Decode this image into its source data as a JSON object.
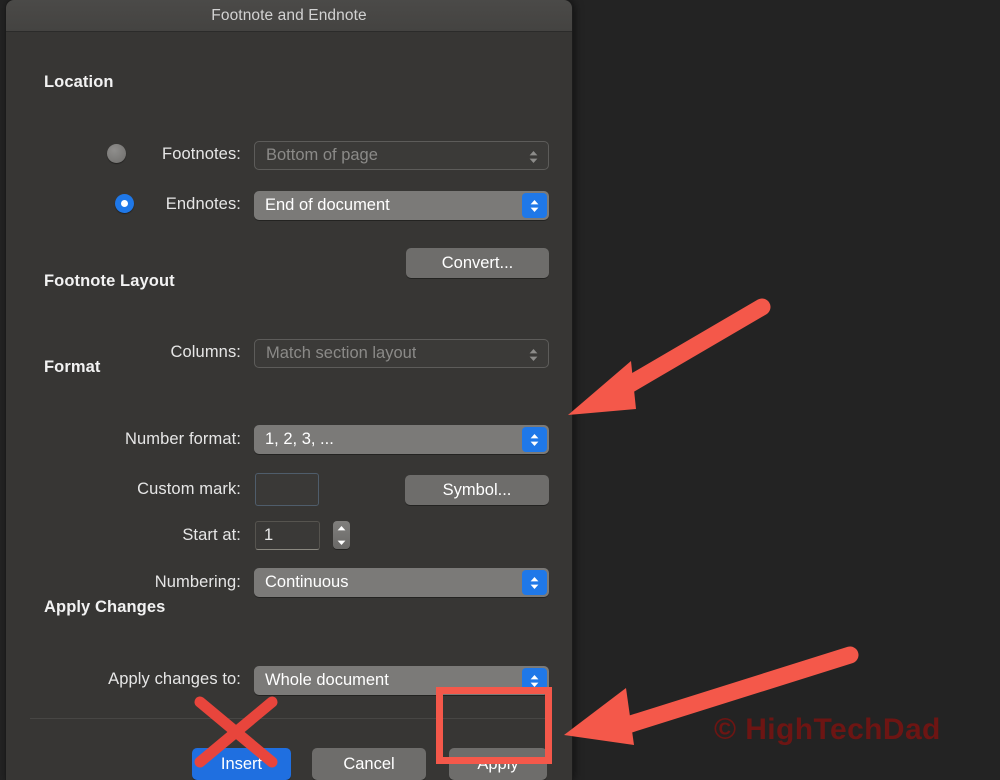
{
  "window": {
    "title": "Footnote and Endnote"
  },
  "sections": {
    "location": "Location",
    "footnote_layout": "Footnote Layout",
    "format": "Format",
    "apply_changes": "Apply Changes"
  },
  "location": {
    "footnotes_label": "Footnotes:",
    "footnotes_value": "Bottom of page",
    "footnotes_selected": "false",
    "endnotes_label": "Endnotes:",
    "endnotes_value": "End of document",
    "endnotes_selected": "true",
    "convert_label": "Convert..."
  },
  "footnote_layout": {
    "columns_label": "Columns:",
    "columns_value": "Match section layout"
  },
  "format": {
    "number_format_label": "Number format:",
    "number_format_value": "1, 2, 3, ...",
    "custom_mark_label": "Custom mark:",
    "custom_mark_value": "",
    "symbol_label": "Symbol...",
    "start_at_label": "Start at:",
    "start_at_value": "1",
    "numbering_label": "Numbering:",
    "numbering_value": "Continuous"
  },
  "apply_changes": {
    "apply_to_label": "Apply changes to:",
    "apply_to_value": "Whole document"
  },
  "buttons": {
    "insert": "Insert",
    "cancel": "Cancel",
    "apply": "Apply"
  },
  "annotations": {
    "watermark": "© HighTechDad",
    "arrow_color": "#f4584a",
    "highlight_color": "#f4584a",
    "cross_color": "#e8453c",
    "watermark_color": "#6d1513"
  },
  "colors": {
    "accent_blue": "#1f78e8",
    "dialog_bg": "#373634",
    "titlebar_bg": "#4b4a48",
    "desktop_bg": "#232323"
  },
  "icons": {
    "popup_arrows": "chevron-up-down-icon",
    "stepper_arrows": "stepper-up-down-icon"
  }
}
